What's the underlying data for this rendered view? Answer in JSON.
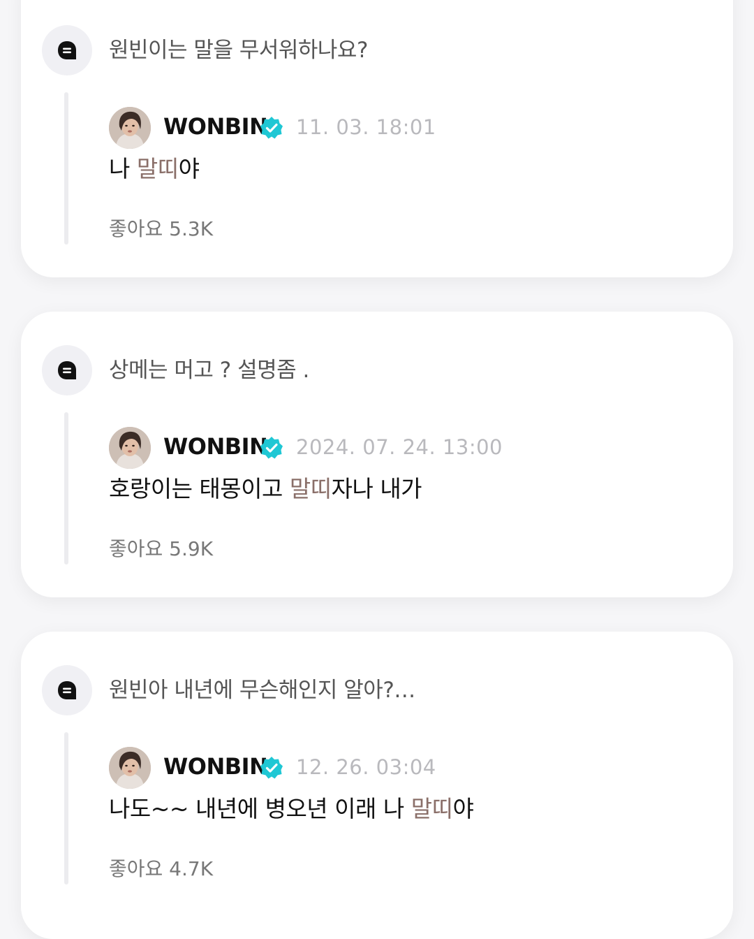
{
  "posts": [
    {
      "question": "원빈이는 말을 무서워하나요?",
      "reply": {
        "name": "WONBIN",
        "date": "11. 03. 18:01",
        "text_before": "나 ",
        "text_highlight": "말띠",
        "text_after": "야"
      },
      "likes": "좋아요 5.3K"
    },
    {
      "question": "상메는 머고 ? 설명좀 .",
      "reply": {
        "name": "WONBIN",
        "date": "2024. 07. 24. 13:00",
        "text_before": "호랑이는 태몽이고 ",
        "text_highlight": "말띠",
        "text_after": "자나 내가"
      },
      "likes": "좋아요 5.9K"
    },
    {
      "question": "원빈아 내년에 무슨해인지 알아?…",
      "reply": {
        "name": "WONBIN",
        "date": "12. 26. 03:04",
        "text_before": "나도~~ 내년에 병오년 이래 나 ",
        "text_highlight": "말띠",
        "text_after": "야"
      },
      "likes": "좋아요 4.7K"
    }
  ],
  "colors": {
    "highlight": "#8a6f69",
    "verified": "#1fc7d4",
    "card_background": "#ffffff",
    "page_background": "#f6f6f8"
  },
  "icons": {
    "question_avatar": "chat-bubble-icon",
    "verified": "verified-check-icon"
  }
}
